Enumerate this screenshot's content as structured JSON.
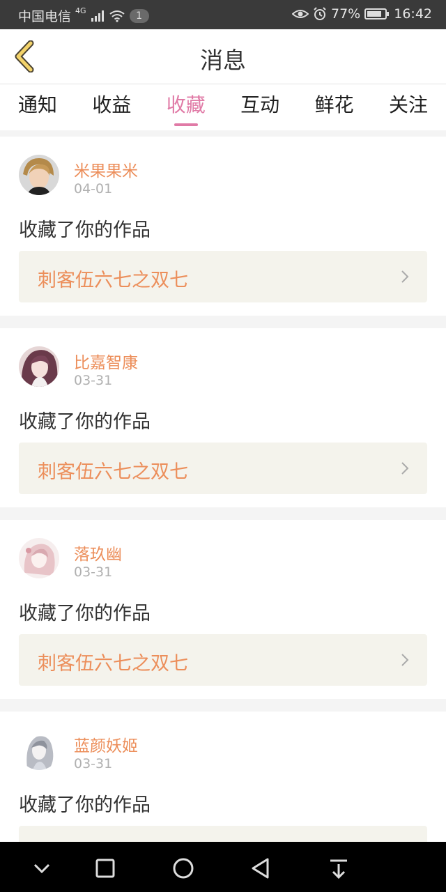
{
  "status_bar": {
    "carrier": "中国电信",
    "network": "4G",
    "notification_count": "1",
    "battery": "77%",
    "time": "16:42"
  },
  "header": {
    "title": "消息"
  },
  "tabs": [
    {
      "label": "通知",
      "active": false
    },
    {
      "label": "收益",
      "active": false
    },
    {
      "label": "收藏",
      "active": true
    },
    {
      "label": "互动",
      "active": false
    },
    {
      "label": "鲜花",
      "active": false
    },
    {
      "label": "关注",
      "active": false
    }
  ],
  "messages": [
    {
      "user": "米果果米",
      "date": "04-01",
      "text": "收藏了你的作品",
      "work_title": "刺客伍六七之双七"
    },
    {
      "user": "比嘉智康",
      "date": "03-31",
      "text": "收藏了你的作品",
      "work_title": "刺客伍六七之双七"
    },
    {
      "user": "落玖幽",
      "date": "03-31",
      "text": "收藏了你的作品",
      "work_title": "刺客伍六七之双七"
    },
    {
      "user": "蓝颜妖姬",
      "date": "03-31",
      "text": "收藏了你的作品",
      "work_title": ""
    }
  ],
  "colors": {
    "accent": "#e07aa6",
    "username": "#ec8e5a",
    "work_bg": "#f4f3ec"
  }
}
